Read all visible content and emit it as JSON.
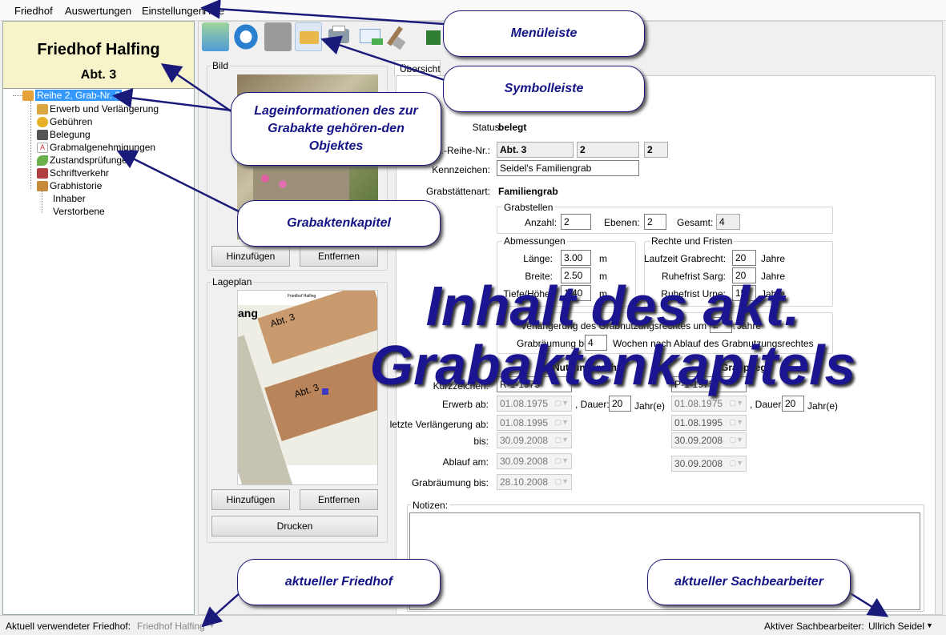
{
  "menu": {
    "items": [
      "Friedhof",
      "Auswertungen",
      "Einstellungen",
      "Hilfe"
    ]
  },
  "cemetery": {
    "name": "Friedhof Halfing",
    "section": "Abt. 3"
  },
  "tree": {
    "root": "Reihe 2, Grab-Nr. 2",
    "items": [
      "Erwerb und Verlängerung",
      "Gebühren",
      "Belegung",
      "Grabmalgenehmigungen",
      "Zustandsprüfungen",
      "Schriftverkehr",
      "Grabhistorie"
    ],
    "sub": [
      "Inhaber",
      "Verstorbene"
    ]
  },
  "toolbar": {
    "icons": [
      "map-search-icon",
      "refresh-icon",
      "grid-icon",
      "folder-open-icon",
      "printer-icon",
      "email-icon",
      "shovel-icon",
      "exit-icon"
    ]
  },
  "bild": {
    "label": "Bild",
    "add": "Hinzufügen",
    "remove": "Entfernen"
  },
  "lageplan": {
    "label": "Lageplan",
    "add": "Hinzufügen",
    "remove": "Entfernen",
    "print": "Drucken",
    "map_labels": [
      "Friedhof Halfing",
      "Abt. 3",
      "Abt. 3",
      "ang"
    ]
  },
  "tab": {
    "label": "Übersicht"
  },
  "overview": {
    "status_label": "Status:",
    "status_value": "belegt",
    "abt_label": "Abt.-Reihe-Nr.:",
    "abt": "Abt. 3",
    "reihe": "2",
    "nr": "2",
    "kennzeichen_label": "Kennzeichen:",
    "kennzeichen": "Seidel's Familiengrab",
    "art_label": "Grabstättenart:",
    "art": "Familiengrab",
    "grabstellen": {
      "title": "Grabstellen",
      "anzahl_label": "Anzahl:",
      "anzahl": "2",
      "ebenen_label": "Ebenen:",
      "ebenen": "2",
      "gesamt_label": "Gesamt:",
      "gesamt": "4"
    },
    "abmessungen": {
      "title": "Abmessungen",
      "laenge_label": "Länge:",
      "laenge": "3.00",
      "breite_label": "Breite:",
      "breite": "2.50",
      "tiefe_label": "Tiefe/Höhe:",
      "tiefe": "1.40",
      "unit": "m"
    },
    "rechte": {
      "title": "Rechte und Fristen",
      "laufzeit_label": "Laufzeit Grabrecht:",
      "laufzeit": "20",
      "sarg_label": "Ruhefrist Sarg:",
      "sarg": "20",
      "urne_label": "Ruhefrist Urne:",
      "urne": "15",
      "unit": "Jahre"
    },
    "fristen": {
      "title": "Fristen",
      "verlaengerung_label": "Verlängerung des Grabnutzungsrechtes um mind.:",
      "verlaengerung": "2",
      "verlaengerung_unit": "Jahre",
      "raeumung_label": "Grabräumung bis",
      "raeumung": "4",
      "raeumung_suffix": "Wochen nach Ablauf des Grabnutzungsrechtes"
    },
    "nutzungsrecht": {
      "title": "Nutzungsrecht",
      "kurz_label": "Kurzzeichen:",
      "kurz": "R-1-1975",
      "erwerb_label": "Erwerb ab:",
      "erwerb": "01.08.1975",
      "dauer_label": ", Dauer:",
      "dauer": "20",
      "dauer_unit": "Jahr(e)",
      "lv_label": "letzte Verlängerung ab:",
      "lv": "01.08.1995",
      "bis_label": "bis:",
      "bis": "30.09.2008",
      "ablauf_label": "Ablauf am:",
      "ablauf": "30.09.2008",
      "raeumung_label": "Grabräumung bis:",
      "raeumung": "28.10.2008"
    },
    "grabpflege": {
      "title": "Grabpflege",
      "kurz": "P-1-1975",
      "erwerb": "01.08.1975",
      "dauer": "20",
      "lv": "01.08.1995",
      "bis": "30.09.2008",
      "ablauf": "30.09.2008"
    },
    "notizen_label": "Notizen:"
  },
  "status": {
    "friedhof_label": "Aktuell verwendeter Friedhof:",
    "friedhof": "Friedhof Halfing",
    "bearbeiter_label": "Aktiver Sachbearbeiter:",
    "bearbeiter": "Ullrich Seidel"
  },
  "callouts": {
    "menuleiste": "Menüleiste",
    "symbolleiste": "Symbolleiste",
    "lage": "Lageinformationen des zur Grabakte gehören-den Objektes",
    "kapitel": "Grabaktenkapitel",
    "friedhof": "aktueller Friedhof",
    "bearbeiter": "aktueller Sachbearbeiter",
    "big": "Inhalt des akt. Grabaktenkapitels"
  },
  "colors": {
    "callout_text": "#141487",
    "panel_yellow": "#f7f4c9",
    "selection": "#3399ff"
  }
}
